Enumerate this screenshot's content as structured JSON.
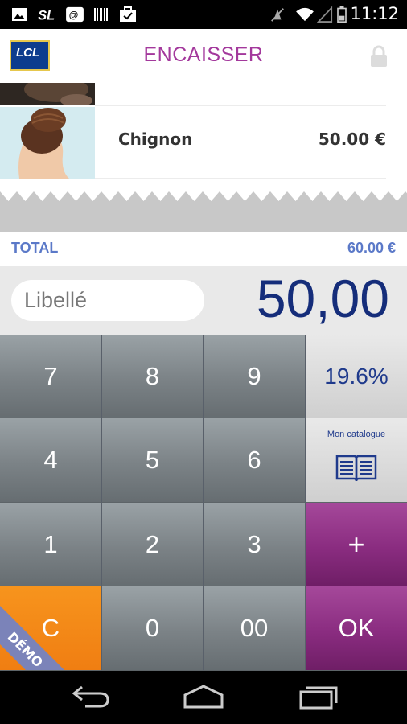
{
  "status_bar": {
    "time": "11:12",
    "icons": [
      "image-icon",
      "sl-icon",
      "voicemail-icon",
      "barcode-icon",
      "briefcase-icon",
      "mute-icon",
      "wifi-icon",
      "signal-icon",
      "battery-icon"
    ]
  },
  "app_bar": {
    "logo_text": "LCL",
    "title": "ENCAISSER",
    "lock_icon": "lock-icon"
  },
  "items": [
    {
      "name": "",
      "price": ""
    },
    {
      "name": "Chignon",
      "price": "50.00 €"
    }
  ],
  "total": {
    "label": "TOTAL",
    "value": "60.00 €"
  },
  "entry": {
    "label_placeholder": "Libellé",
    "amount": "50,00"
  },
  "keypad": {
    "keys": [
      "7",
      "8",
      "9",
      "4",
      "5",
      "6",
      "1",
      "2",
      "3",
      "C",
      "0",
      "00"
    ],
    "vat": "19.6%",
    "catalog_label": "Mon catalogue",
    "plus": "+",
    "ok": "OK",
    "demo": "DÉMO"
  },
  "colors": {
    "title": "#a3389c",
    "total": "#5b79c8",
    "amount": "#152d7a",
    "purple": "#8a2c80",
    "orange": "#f28a18"
  },
  "nav_bar": {
    "buttons": [
      "back-icon",
      "home-icon",
      "recent-apps-icon"
    ]
  }
}
